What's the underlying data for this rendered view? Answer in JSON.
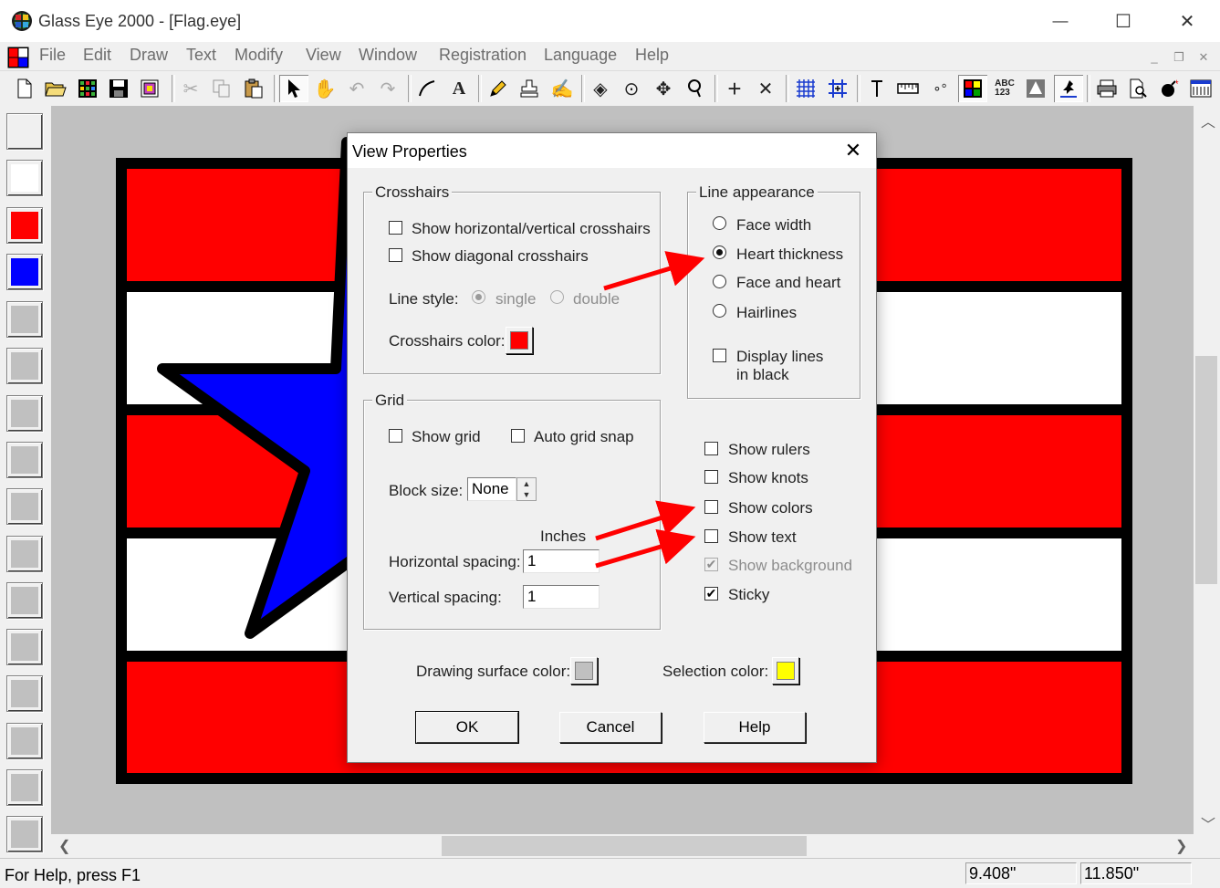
{
  "window": {
    "title": "Glass Eye 2000 - [Flag.eye]",
    "controls": {
      "minimize": "—",
      "maximize": "☐",
      "close": "✕"
    }
  },
  "menubar": {
    "items": [
      "File",
      "Edit",
      "Draw",
      "Text",
      "Modify",
      "View",
      "Window",
      "Registration",
      "Language",
      "Help"
    ],
    "mdi": {
      "minimize": "_",
      "restore": "❐",
      "close": "✕"
    }
  },
  "toolbar": {
    "icons": [
      "new-file-icon",
      "open-folder-icon",
      "grid-pattern-icon",
      "save-icon",
      "library-icon",
      "cut-icon",
      "copy-icon",
      "paste-icon",
      "select-arrow-icon",
      "hand-icon",
      "undo-icon",
      "redo-icon",
      "line-draw-icon",
      "text-tool-icon",
      "pencil-icon",
      "stamp-icon",
      "lasso-icon",
      "fill-icon",
      "circle-point-icon",
      "move-icon",
      "zoom-icon",
      "crosshair-icon",
      "diagonal-crosshair-icon",
      "grid-icon",
      "grid-snap-icon",
      "pin-icon",
      "ruler-icon",
      "knots-icon",
      "colors-icon",
      "text-abc-icon",
      "background-icon",
      "sticky-icon",
      "print-icon",
      "print-preview-icon",
      "bomb-icon",
      "window-icon"
    ]
  },
  "palette": {
    "colors": [
      "#ffffff",
      "#ff0000",
      "#0000ff"
    ],
    "empty_color": "#c0c0c0"
  },
  "canvas": {
    "surface_color": "#c0c0c0",
    "flag_red": "#ff0000",
    "flag_white": "#ffffff",
    "star_color": "#0000ff",
    "outline_color": "#000000"
  },
  "statusbar": {
    "help_text": "For Help, press F1",
    "coord_x": "9.408\"",
    "coord_y": "11.850\""
  },
  "dialog": {
    "title": "View Properties",
    "close": "✕",
    "crosshairs": {
      "label": "Crosshairs",
      "show_hv": "Show horizontal/vertical crosshairs",
      "show_diag": "Show diagonal crosshairs",
      "line_style_label": "Line style:",
      "single": "single",
      "double": "double",
      "color_label": "Crosshairs color:",
      "color": "#ff0000"
    },
    "line_appearance": {
      "label": "Line appearance",
      "options": [
        "Face width",
        "Heart thickness",
        "Face and heart",
        "Hairlines"
      ],
      "selected": "Heart thickness",
      "display_black_line1": "Display lines",
      "display_black_line2": "in black"
    },
    "grid": {
      "label": "Grid",
      "show_grid": "Show grid",
      "auto_snap": "Auto grid snap",
      "block_size_label": "Block size:",
      "block_size_value": "None",
      "units": "Inches",
      "h_spacing_label": "Horizontal spacing:",
      "h_spacing_value": "1",
      "v_spacing_label": "Vertical spacing:",
      "v_spacing_value": "1"
    },
    "options": {
      "show_rulers": "Show rulers",
      "show_knots": "Show knots",
      "show_colors": "Show colors",
      "show_text": "Show text",
      "show_background": "Show background",
      "sticky": "Sticky"
    },
    "surface_color_label": "Drawing surface color:",
    "surface_color": "#c0c0c0",
    "selection_color_label": "Selection color:",
    "selection_color": "#ffff00",
    "buttons": {
      "ok": "OK",
      "cancel": "Cancel",
      "help": "Help"
    }
  },
  "annotation": {
    "arrow_color": "#ff0000"
  }
}
